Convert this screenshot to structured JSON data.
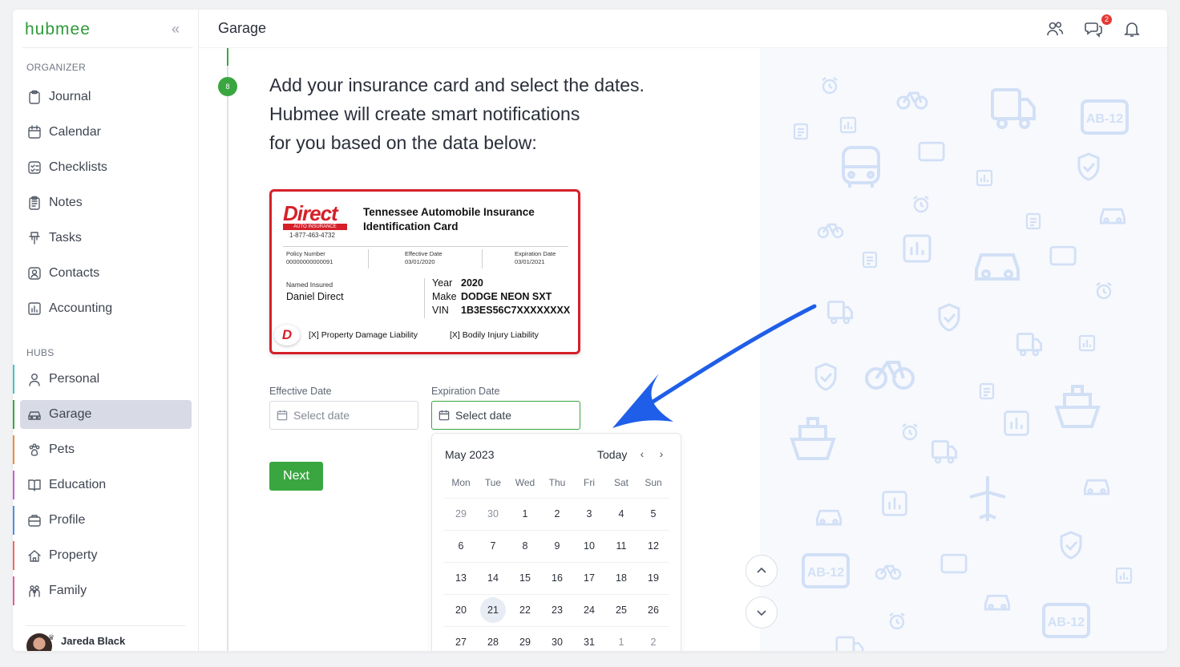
{
  "app": {
    "logo": "hubmee",
    "collapse_icon": "chevrons-left-icon"
  },
  "sidebar": {
    "organizer_title": "ORGANIZER",
    "organizer_items": [
      {
        "label": "Journal",
        "icon": "clipboard-icon"
      },
      {
        "label": "Calendar",
        "icon": "calendar-icon"
      },
      {
        "label": "Checklists",
        "icon": "checklist-icon"
      },
      {
        "label": "Notes",
        "icon": "note-icon"
      },
      {
        "label": "Tasks",
        "icon": "pushpin-icon"
      },
      {
        "label": "Contacts",
        "icon": "contact-icon"
      },
      {
        "label": "Accounting",
        "icon": "chart-icon"
      }
    ],
    "hubs_title": "HUBS",
    "hub_items": [
      {
        "label": "Personal",
        "icon": "person-icon",
        "color": "#3cc6c9"
      },
      {
        "label": "Garage",
        "icon": "car-icon",
        "color": "#3aa640",
        "active": true
      },
      {
        "label": "Pets",
        "icon": "paw-icon",
        "color": "#f08a3c"
      },
      {
        "label": "Education",
        "icon": "book-icon",
        "color": "#c65fd6"
      },
      {
        "label": "Profile",
        "icon": "briefcase-icon",
        "color": "#4a90e2"
      },
      {
        "label": "Property",
        "icon": "home-icon",
        "color": "#f0695f"
      },
      {
        "label": "Family",
        "icon": "family-icon",
        "color": "#e35d9a"
      }
    ],
    "user_name": "Jareda Black"
  },
  "header": {
    "title": "Garage",
    "chat_badge": "2"
  },
  "step": {
    "number": "8",
    "line1": "Add your insurance card and select the dates.",
    "line2": "Hubmee will create smart notifications",
    "line3": "for you based on the data below:"
  },
  "card": {
    "brand": "Direct",
    "brand_sub": "AUTO INSURANCE",
    "phone": "1-877-463-4732",
    "title": "Tennessee Automobile Insurance Identification Card",
    "policy_label": "Policy Number",
    "policy_value": "00000000000091",
    "eff_label": "Effective Date",
    "eff_value": "03/01/2020",
    "exp_label": "Expiration Date",
    "exp_value": "03/01/2021",
    "insured_label": "Named Insured",
    "insured_value": "Daniel Direct",
    "year_label": "Year",
    "year_value": "2020",
    "make_label": "Make",
    "make_value": "DODGE NEON SXT",
    "vin_label": "VIN",
    "vin_value": "1B3ES56C7XXXXXXXX",
    "coverage1": "[X] Property Damage Liability",
    "coverage2": "[X] Bodily Injury Liability"
  },
  "form": {
    "effective_label": "Effective Date",
    "effective_placeholder": "Select date",
    "expiration_label": "Expiration Date",
    "expiration_placeholder": "Select date",
    "next_label": "Next"
  },
  "calendar": {
    "month": "May 2023",
    "today_label": "Today",
    "weekdays": [
      "Mon",
      "Tue",
      "Wed",
      "Thu",
      "Fri",
      "Sat",
      "Sun"
    ],
    "weeks": [
      [
        "29",
        "30",
        "1",
        "2",
        "3",
        "4",
        "5"
      ],
      [
        "6",
        "7",
        "8",
        "9",
        "10",
        "11",
        "12"
      ],
      [
        "13",
        "14",
        "15",
        "16",
        "17",
        "18",
        "19"
      ],
      [
        "20",
        "21",
        "22",
        "23",
        "24",
        "25",
        "26"
      ],
      [
        "27",
        "28",
        "29",
        "30",
        "31",
        "1",
        "2"
      ]
    ],
    "today": "21"
  },
  "colors": {
    "accent": "#3aa640",
    "arrow": "#1f5ee8",
    "pattern": "#d2e0f6"
  }
}
